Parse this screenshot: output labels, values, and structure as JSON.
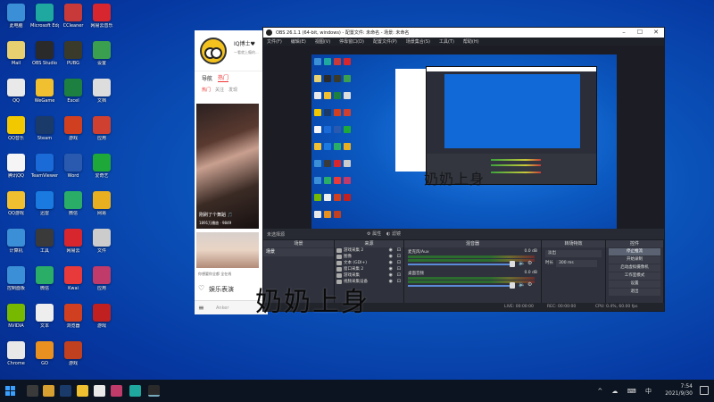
{
  "desktop": {
    "icons": [
      {
        "label": "此电脑",
        "color": "#3b8fd6"
      },
      {
        "label": "Microsoft Edge",
        "color": "#1fa8a0"
      },
      {
        "label": "CCleaner",
        "color": "#c83a3a"
      },
      {
        "label": "网易云音乐",
        "color": "#d8262e"
      },
      {
        "label": "Mail",
        "color": "#e6d070"
      },
      {
        "label": "OBS Studio",
        "color": "#2a2a2a"
      },
      {
        "label": "PUBG",
        "color": "#3a3a2a"
      },
      {
        "label": "设置",
        "color": "#3aa050"
      },
      {
        "label": "QQ",
        "color": "#e9e9e9"
      },
      {
        "label": "WeGame",
        "color": "#f0c030"
      },
      {
        "label": "Excel",
        "color": "#1e8040"
      },
      {
        "label": "文档",
        "color": "#dddddd"
      },
      {
        "label": "QQ音乐",
        "color": "#f2c800"
      },
      {
        "label": "Steam",
        "color": "#1a3a6a"
      },
      {
        "label": "游戏",
        "color": "#d04020"
      },
      {
        "label": "应用",
        "color": "#d04030"
      },
      {
        "label": "腾讯QQ",
        "color": "#f5f5f5"
      },
      {
        "label": "TeamViewer",
        "color": "#1a6ad8"
      },
      {
        "label": "Word",
        "color": "#2a5ab0"
      },
      {
        "label": "爱奇艺",
        "color": "#1fa83a"
      },
      {
        "label": "QQ游戏",
        "color": "#f0c030"
      },
      {
        "label": "迅雷",
        "color": "#1a7ae0"
      },
      {
        "label": "微信",
        "color": "#2aae67"
      },
      {
        "label": "网易",
        "color": "#e8b020"
      },
      {
        "label": "计算机",
        "color": "#3b8fd6"
      },
      {
        "label": "工具",
        "color": "#3a3a3a"
      },
      {
        "label": "网易云",
        "color": "#d8262e"
      },
      {
        "label": "文件",
        "color": "#cccccc"
      },
      {
        "label": "控制面板",
        "color": "#3b8fd6"
      },
      {
        "label": "微信",
        "color": "#2aae67"
      },
      {
        "label": "Kwai",
        "color": "#e83a3a"
      },
      {
        "label": "应用",
        "color": "#c03a6a"
      },
      {
        "label": "NVIDIA",
        "color": "#76b900"
      },
      {
        "label": "文本",
        "color": "#eeeeee"
      },
      {
        "label": "浏览器",
        "color": "#d04020"
      },
      {
        "label": "游戏",
        "color": "#c02020"
      },
      {
        "label": "Chrome",
        "color": "#e8e8e8"
      },
      {
        "label": "GO",
        "color": "#e89020"
      },
      {
        "label": "游戏",
        "color": "#c04020"
      }
    ]
  },
  "phone": {
    "name": "IQ博士♥",
    "subtitle": "一看就上瘾的...",
    "tabs": [
      "导航",
      "热门"
    ],
    "subtabs": [
      "热门",
      "关注",
      "发现"
    ],
    "video_caption": "刚刷了个舞蹈 🎵",
    "video_meta": "1891万播放 · 9849",
    "caption2": "你想要你全都 全在线",
    "ent_label": "娱乐表演",
    "bottom_hint": "Anker"
  },
  "obs": {
    "title": "OBS 26.1.1 (64-bit, windows) - 配置文件: 未命名 - 场景: 未命名",
    "menu": [
      "文件(F)",
      "编辑(E)",
      "视图(V)",
      "停靠窗口(D)",
      "配置文件(P)",
      "场景集合(S)",
      "工具(T)",
      "帮助(H)"
    ],
    "toolbar": {
      "no_scene": "未选择源",
      "props": "属性",
      "filters": "滤镜"
    },
    "docks": {
      "scenes": {
        "header": "场景",
        "items": [
          "场景"
        ]
      },
      "sources": {
        "header": "来源",
        "items": [
          "游戏采集 2",
          "图像",
          "文本 (GDI+)",
          "窗口采集 2",
          "游戏采集",
          "视频采集设备"
        ]
      },
      "mixer": {
        "header": "混音器",
        "channels": [
          {
            "name": "麦克风/Aux",
            "db": "0.0 dB"
          },
          {
            "name": "桌面音频",
            "db": "0.0 dB"
          }
        ]
      },
      "transitions": {
        "header": "转场特效",
        "type": "淡出",
        "duration_label": "时长",
        "duration": "300 ms"
      },
      "controls": {
        "header": "控件",
        "buttons": [
          "停止推流",
          "开始录制",
          "启动虚拟摄像机",
          "工作室模式",
          "设置",
          "退出"
        ]
      }
    },
    "status": {
      "live": "LIVE: 00:00:00",
      "rec": "REC: 00:00:00",
      "cpu": "CPU: 0.4%, 60.00 fps"
    }
  },
  "watermark": "奶奶上身",
  "taskbar": {
    "time": "7:54",
    "date": "2021/9/30",
    "tray_icons": "^ ☁ ⌨ 中"
  }
}
